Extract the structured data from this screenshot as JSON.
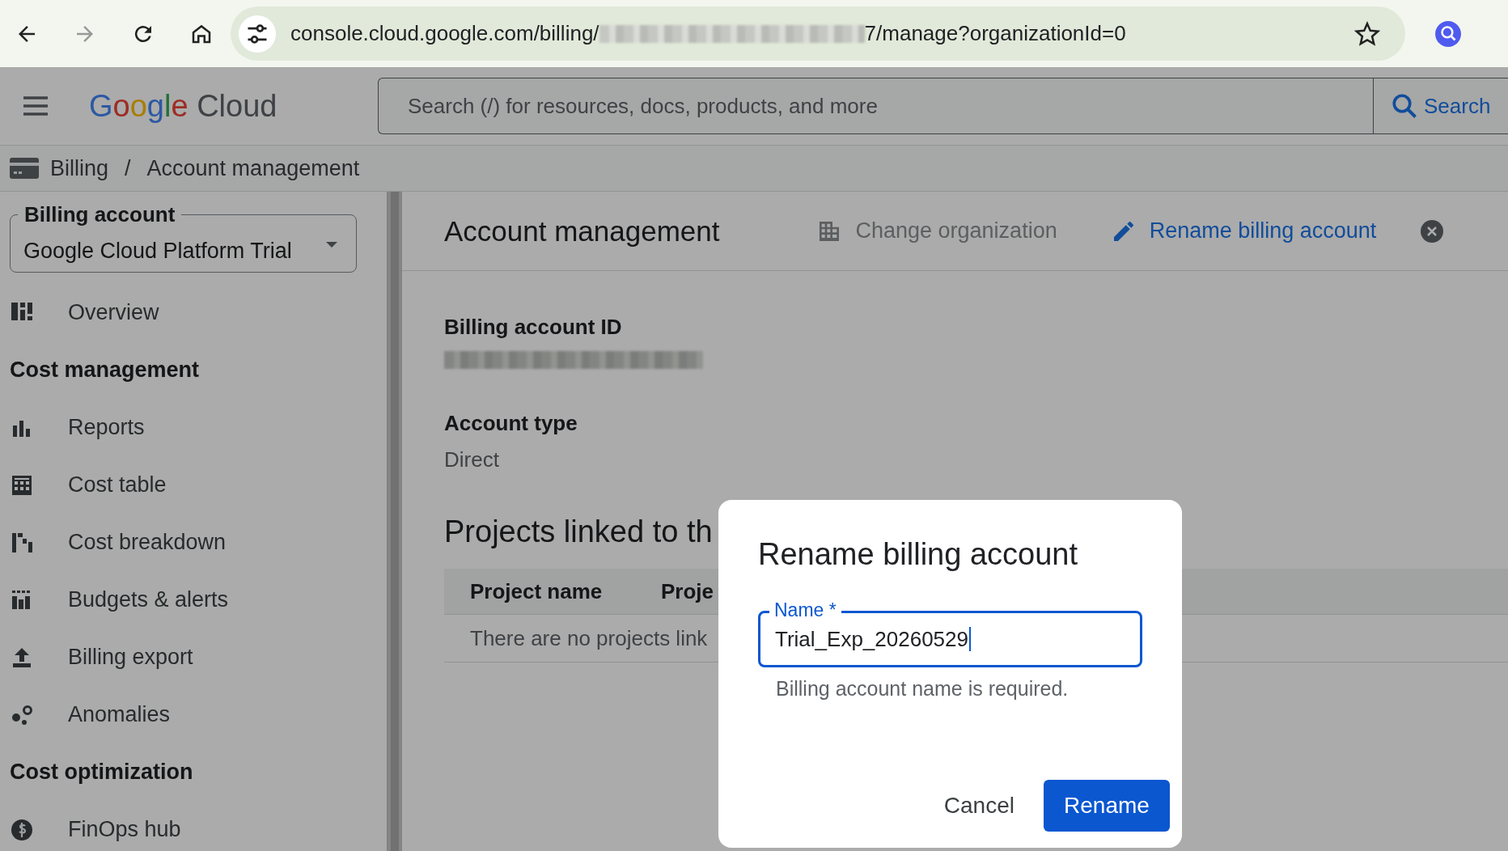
{
  "browser": {
    "url_start": "console.cloud.google.com/billing/",
    "url_end": "7/manage?organizationId=0"
  },
  "app_bar": {
    "logo_brand": "Google",
    "logo_product": "Cloud",
    "search": {
      "placeholder": "Search (/) for resources, docs, products, and more"
    },
    "search_button": "Search"
  },
  "breadcrumb": {
    "items": [
      "Billing",
      "Account management"
    ],
    "separator": "/"
  },
  "sidebar": {
    "account_selector": {
      "label": "Billing account",
      "value": "Google Cloud Platform Trial"
    },
    "items": [
      {
        "kind": "link",
        "label": "Overview"
      },
      {
        "kind": "heading",
        "label": "Cost management"
      },
      {
        "kind": "link",
        "label": "Reports"
      },
      {
        "kind": "link",
        "label": "Cost table"
      },
      {
        "kind": "link",
        "label": "Cost breakdown"
      },
      {
        "kind": "link",
        "label": "Budgets & alerts"
      },
      {
        "kind": "link",
        "label": "Billing export"
      },
      {
        "kind": "link",
        "label": "Anomalies"
      },
      {
        "kind": "heading",
        "label": "Cost optimization"
      },
      {
        "kind": "link",
        "label": "FinOps hub"
      }
    ]
  },
  "main": {
    "title": "Account management",
    "actions": [
      {
        "label": "Change organization",
        "disabled": true
      },
      {
        "label": "Rename billing account",
        "disabled": false
      }
    ],
    "fields": [
      {
        "label": "Billing account ID"
      },
      {
        "label": "Account type",
        "value": "Direct"
      }
    ],
    "section_heading": "Projects linked to th",
    "table": {
      "columns": [
        "Project name",
        "Proje"
      ],
      "empty_text": "There are no projects link"
    }
  },
  "dialog": {
    "title": "Rename billing account",
    "field": {
      "label": "Name *",
      "value": "Trial_Exp_20260529",
      "focused": true
    },
    "helper": "Billing account name is required.",
    "buttons": [
      {
        "label": "Cancel",
        "kind": "text"
      },
      {
        "label": "Rename",
        "kind": "primary"
      }
    ]
  }
}
